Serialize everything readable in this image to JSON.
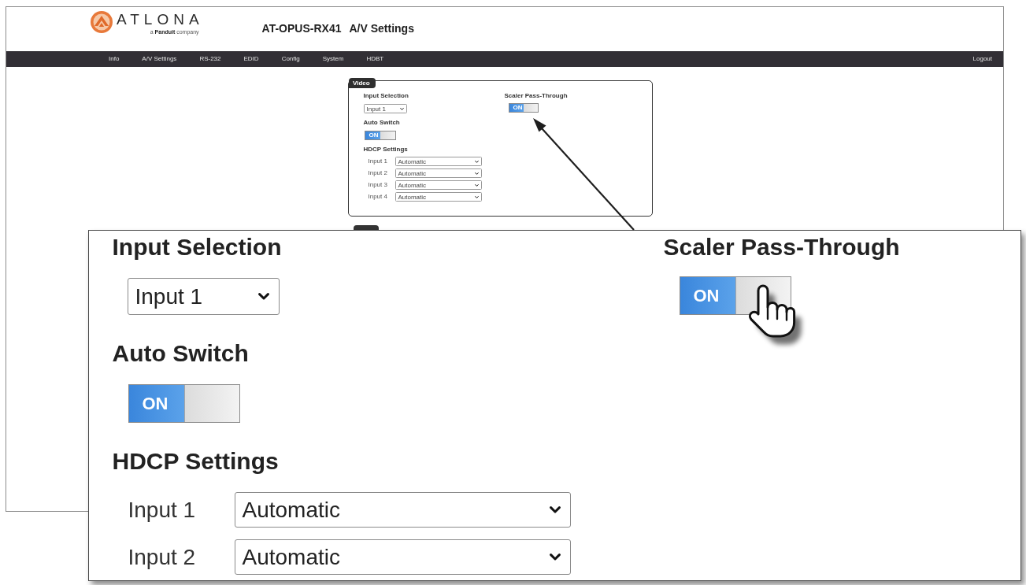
{
  "header": {
    "logo": {
      "wordmark": "ATLONA",
      "tagline": "a **Panduit** company"
    },
    "device_name": "AT-OPUS-RX41",
    "page_title": "A/V Settings"
  },
  "nav": {
    "items": [
      "Info",
      "A/V Settings",
      "RS-232",
      "EDID",
      "Config",
      "System",
      "HDBT"
    ],
    "logout": "Logout"
  },
  "video_panel": {
    "legend": "Video",
    "input_selection": {
      "label": "Input Selection",
      "value": "Input 1"
    },
    "auto_switch": {
      "label": "Auto Switch",
      "toggle": {
        "label": "ON",
        "on": true
      }
    },
    "hdcp_settings": {
      "label": "HDCP Settings",
      "inputs": [
        {
          "label": "Input 1",
          "value": "Automatic"
        },
        {
          "label": "Input 2",
          "value": "Automatic"
        },
        {
          "label": "Input 3",
          "value": "Automatic"
        },
        {
          "label": "Input 4",
          "value": "Automatic"
        }
      ]
    },
    "scaler_pass_through": {
      "label": "Scaler Pass-Through",
      "toggle": {
        "label": "ON",
        "on": true
      }
    }
  },
  "zoom_view": {
    "input_selection": {
      "label": "Input Selection",
      "value": "Input 1"
    },
    "auto_switch": {
      "label": "Auto Switch",
      "toggle": {
        "label": "ON",
        "on": true
      }
    },
    "hdcp_settings": {
      "label": "HDCP Settings",
      "inputs": [
        {
          "label": "Input 1",
          "value": "Automatic"
        },
        {
          "label": "Input 2",
          "value": "Automatic"
        }
      ]
    },
    "scaler_pass_through": {
      "label": "Scaler Pass-Through",
      "toggle": {
        "label": "ON",
        "on": true
      }
    }
  }
}
